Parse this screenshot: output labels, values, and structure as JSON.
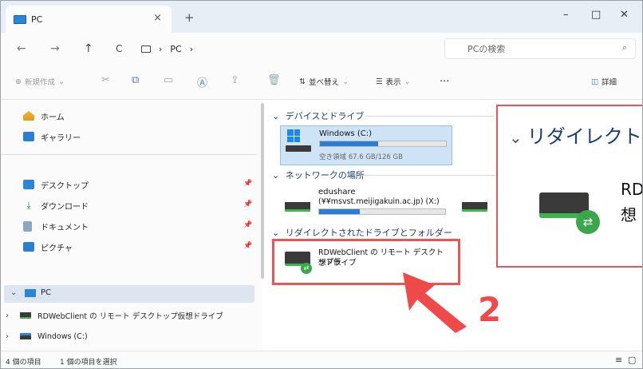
{
  "colors": {
    "accent": "#2a7fd4",
    "highlight": "#e8555b",
    "number": "#ef4a4a",
    "selected_row": "#dde6f0"
  },
  "tab": {
    "title": "PC",
    "close": "×",
    "new": "+"
  },
  "window_controls": {
    "minimize": "–",
    "maximize": "□",
    "close": "✕"
  },
  "nav": {
    "back": "←",
    "forward": "→",
    "up": "↑",
    "refresh": "C",
    "address": [
      "PC"
    ],
    "search_placeholder": "PCの検索",
    "search_icon": "⌕"
  },
  "commands": {
    "new": "新規作成",
    "sort": "並べ替え",
    "view": "表示",
    "more": "...",
    "details": "詳細"
  },
  "sidebar": {
    "quick": [
      {
        "label": "ホーム",
        "icon": "home-icon"
      },
      {
        "label": "ギャラリー",
        "icon": "gallery-icon"
      }
    ],
    "pinned": [
      {
        "label": "デスクトップ",
        "icon": "desktop-icon"
      },
      {
        "label": "ダウンロード",
        "icon": "download-icon"
      },
      {
        "label": "ドキュメント",
        "icon": "document-icon"
      },
      {
        "label": "ピクチャ",
        "icon": "pictures-icon"
      }
    ],
    "tree": {
      "pc": "PC",
      "rdweb": "RDWebClient の リモート デスクトップ仮想ドライブ",
      "windows": "Windows (C:)"
    }
  },
  "content": {
    "group1": "デバイスとドライブ",
    "windows_drive": {
      "name": "Windows (C:)",
      "free": "空き領域 67.6 GB/126 GB",
      "used_fraction": 0.46
    },
    "group2": "ネットワークの場所",
    "net": {
      "name": "edushare",
      "path": "(¥¥msvst.meijigakuin.ac.jp) (X:)",
      "used_fraction": 0.32
    },
    "group3": "リダイレクトされたドライブとフォルダー",
    "rd": {
      "line1": "RDWebClient の リモート デスクトップ仮",
      "line2": "想ドライブ"
    }
  },
  "zoom": {
    "title": "リダイレクト",
    "t1": "RD",
    "t2": "想"
  },
  "annotation": {
    "number": "2"
  },
  "status": {
    "count": "4 個の項目",
    "selected": "1 個の項目を選択"
  }
}
